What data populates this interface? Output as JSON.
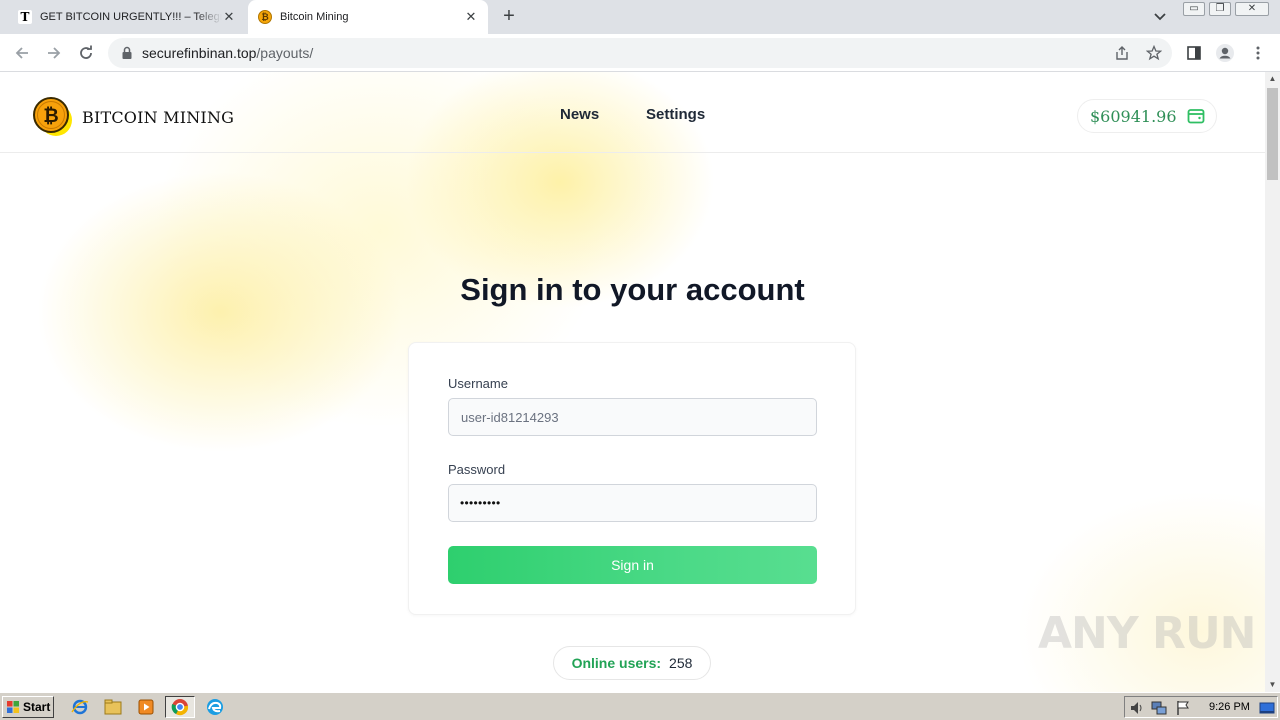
{
  "browser": {
    "tabs": [
      {
        "label": "GET BITCOIN URGENTLY!!! – Telegraph",
        "favicon": "telegraph-t-icon",
        "active": false
      },
      {
        "label": "Bitcoin Mining",
        "favicon": "bitcoin-coin-icon",
        "active": true
      }
    ],
    "new_tab_glyph": "+",
    "close_glyph": "✕",
    "url_host": "securefinbinan.top",
    "url_path": "/payouts/"
  },
  "site": {
    "brand": "BITCOIN MINING",
    "nav": {
      "news": "News",
      "settings": "Settings"
    },
    "balance": "$60941.96"
  },
  "login": {
    "title": "Sign in to your account",
    "username_label": "Username",
    "username_placeholder": "user-id81214293",
    "password_label": "Password",
    "password_mask": "•••••••••",
    "submit_label": "Sign in"
  },
  "online": {
    "label": "Online users:",
    "count": "258"
  },
  "watermark": "ANY RUN",
  "taskbar": {
    "start_label": "Start",
    "clock": "9:26 PM"
  },
  "colors": {
    "accent_green": "#34d173",
    "balance_green": "#2f8f57",
    "online_green": "#22a356",
    "bitcoin_orange": "#f7a10b"
  }
}
